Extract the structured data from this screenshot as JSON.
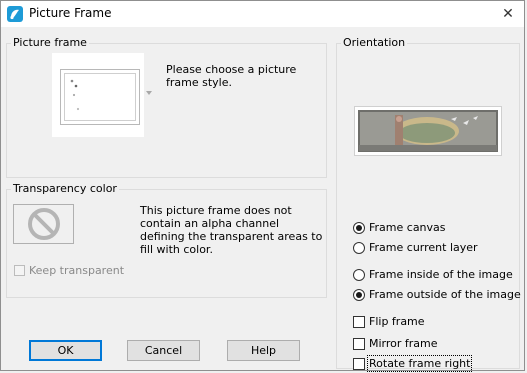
{
  "window": {
    "title": "Picture Frame",
    "app_icon": "paint-shop-icon",
    "close_glyph": "✕"
  },
  "picture_frame": {
    "group_label": "Picture frame",
    "instruction": "Please choose a picture frame style."
  },
  "transparency": {
    "group_label": "Transparency color",
    "message": "This picture frame does not contain an alpha channel defining the transparent areas to fill with color.",
    "keep_transparent_label": "Keep transparent",
    "keep_transparent_checked": false,
    "keep_transparent_enabled": false,
    "icon": "prohibited-icon"
  },
  "orientation": {
    "group_label": "Orientation",
    "frame_target": [
      {
        "label": "Frame canvas",
        "selected": true
      },
      {
        "label": "Frame current layer",
        "selected": false
      }
    ],
    "frame_position": [
      {
        "label": "Frame inside of the image",
        "selected": false
      },
      {
        "label": "Frame outside of the image",
        "selected": true
      }
    ],
    "options": [
      {
        "label": "Flip frame",
        "checked": false
      },
      {
        "label": "Mirror frame",
        "checked": false
      },
      {
        "label": "Rotate frame right",
        "checked": false
      }
    ]
  },
  "buttons": {
    "ok": "OK",
    "cancel": "Cancel",
    "help": "Help"
  },
  "colors": {
    "accent": "#0078d7",
    "background": "#f0f0f0",
    "prohibited_icon": "#b5b5b5"
  }
}
